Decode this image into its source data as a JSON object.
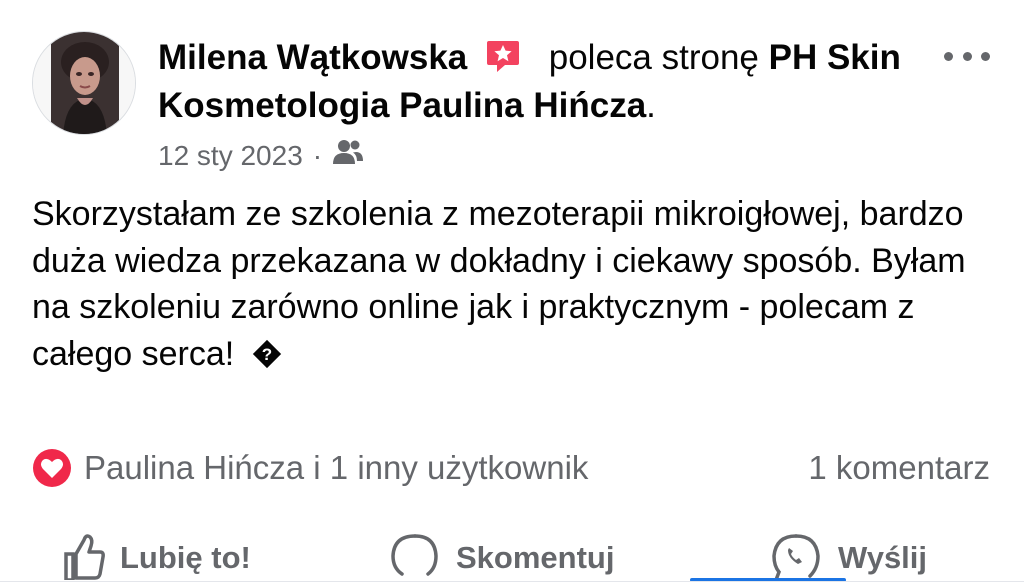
{
  "post": {
    "author": "Milena Wątkowska",
    "verb": "poleca stronę",
    "page_name": "PH Skin Kosmetologia Paulina Hińcza",
    "page_name_suffix": ".",
    "date": "12 sty 2023",
    "date_separator": "·",
    "audience_icon": "friends-icon",
    "recommend_badge_icon": "recommend-star-icon",
    "body": "Skorzystałam ze szkolenia z mezoterapii mikroigłowej, bardzo duża wiedza przekazana w dokładny i ciekawy sposób. Byłam na szkoleniu zarówno online jak i praktycznym - polecam z całego serca!",
    "body_emoji": "unknown-emoji-placeholder"
  },
  "reactions": {
    "icon": "love-reaction-icon",
    "summary": "Paulina Hińcza i 1 inny użytkownik",
    "comments": "1 komentarz"
  },
  "actions": {
    "like": "Lubię to!",
    "comment": "Skomentuj",
    "send": "Wyślij"
  },
  "colors": {
    "text": "#050505",
    "secondary": "#65676b",
    "accent": "#1b74e4",
    "love": "#f0284a",
    "badge": "#f3425f"
  }
}
